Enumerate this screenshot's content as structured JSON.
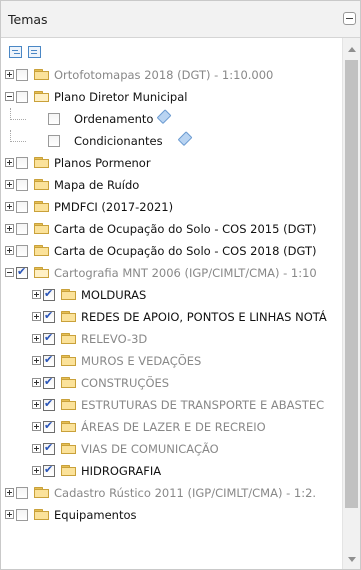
{
  "panel": {
    "title": "Temas"
  },
  "toolbar": {
    "expand_icon": "expand-tree-icon",
    "list_icon": "list-icon"
  },
  "tree": [
    {
      "label": "Ortofotomapas 2018 (DGT) - 1:10.000",
      "level": 0,
      "expander": "plus",
      "checked": false,
      "folder": true,
      "open": false,
      "tone": "grey",
      "tag": false
    },
    {
      "label": "Plano Diretor Municipal",
      "level": 0,
      "expander": "minus",
      "checked": false,
      "folder": true,
      "open": true,
      "tone": "dark",
      "tag": false
    },
    {
      "label": "Ordenamento",
      "level": 1,
      "expander": "none",
      "checked": false,
      "folder": false,
      "open": false,
      "tone": "dark",
      "tag": true
    },
    {
      "label": "Condicionantes",
      "level": 1,
      "expander": "none",
      "checked": false,
      "folder": false,
      "open": false,
      "tone": "dark",
      "tag": true
    },
    {
      "label": "Planos Pormenor",
      "level": 0,
      "expander": "plus",
      "checked": false,
      "folder": true,
      "open": false,
      "tone": "dark",
      "tag": false
    },
    {
      "label": "Mapa de Ruído",
      "level": 0,
      "expander": "plus",
      "checked": false,
      "folder": true,
      "open": false,
      "tone": "dark",
      "tag": false
    },
    {
      "label": "PMDFCI (2017-2021)",
      "level": 0,
      "expander": "plus",
      "checked": false,
      "folder": true,
      "open": false,
      "tone": "dark",
      "tag": false
    },
    {
      "label": "Carta de Ocupação do Solo - COS 2015 (DGT)",
      "level": 0,
      "expander": "plus",
      "checked": false,
      "folder": true,
      "open": false,
      "tone": "dark",
      "tag": false
    },
    {
      "label": "Carta de Ocupação do Solo - COS 2018 (DGT)",
      "level": 0,
      "expander": "plus",
      "checked": false,
      "folder": true,
      "open": false,
      "tone": "dark",
      "tag": false
    },
    {
      "label": "Cartografia MNT 2006 (IGP/CIMLT/CMA) - 1:10",
      "level": 0,
      "expander": "minus",
      "checked": true,
      "folder": true,
      "open": true,
      "tone": "grey",
      "tag": false
    },
    {
      "label": "MOLDURAS",
      "level": 1,
      "expander": "plus",
      "checked": true,
      "folder": true,
      "open": false,
      "tone": "dark",
      "tag": false
    },
    {
      "label": "REDES DE APOIO, PONTOS E LINHAS NOTÁ",
      "level": 1,
      "expander": "plus",
      "checked": true,
      "folder": true,
      "open": false,
      "tone": "dark",
      "tag": false
    },
    {
      "label": "RELEVO-3D",
      "level": 1,
      "expander": "plus",
      "checked": true,
      "folder": true,
      "open": false,
      "tone": "grey",
      "tag": false
    },
    {
      "label": "MUROS E VEDAÇÕES",
      "level": 1,
      "expander": "plus",
      "checked": true,
      "folder": true,
      "open": false,
      "tone": "grey",
      "tag": false
    },
    {
      "label": "CONSTRUÇÕES",
      "level": 1,
      "expander": "plus",
      "checked": true,
      "folder": true,
      "open": false,
      "tone": "grey",
      "tag": false
    },
    {
      "label": "ESTRUTURAS DE TRANSPORTE E ABASTEC",
      "level": 1,
      "expander": "plus",
      "checked": true,
      "folder": true,
      "open": false,
      "tone": "grey",
      "tag": false
    },
    {
      "label": "ÁREAS DE LAZER E DE RECREIO",
      "level": 1,
      "expander": "plus",
      "checked": true,
      "folder": true,
      "open": false,
      "tone": "grey",
      "tag": false
    },
    {
      "label": "VIAS DE COMUNICAÇÃO",
      "level": 1,
      "expander": "plus",
      "checked": true,
      "folder": true,
      "open": false,
      "tone": "grey",
      "tag": false
    },
    {
      "label": "HIDROGRAFIA",
      "level": 1,
      "expander": "plus",
      "checked": true,
      "folder": true,
      "open": false,
      "tone": "dark",
      "tag": false
    },
    {
      "label": "Cadastro Rústico 2011 (IGP/CIMLT/CMA) - 1:2.",
      "level": 0,
      "expander": "plus",
      "checked": false,
      "folder": true,
      "open": false,
      "tone": "grey",
      "tag": false
    },
    {
      "label": "Equipamentos",
      "level": 0,
      "expander": "plus",
      "checked": false,
      "folder": true,
      "open": false,
      "tone": "dark",
      "tag": false
    }
  ],
  "colors": {
    "grey_text": "#888888",
    "dark_text": "#111111",
    "folder": "#fbe29a",
    "check": "#2a55b8"
  }
}
